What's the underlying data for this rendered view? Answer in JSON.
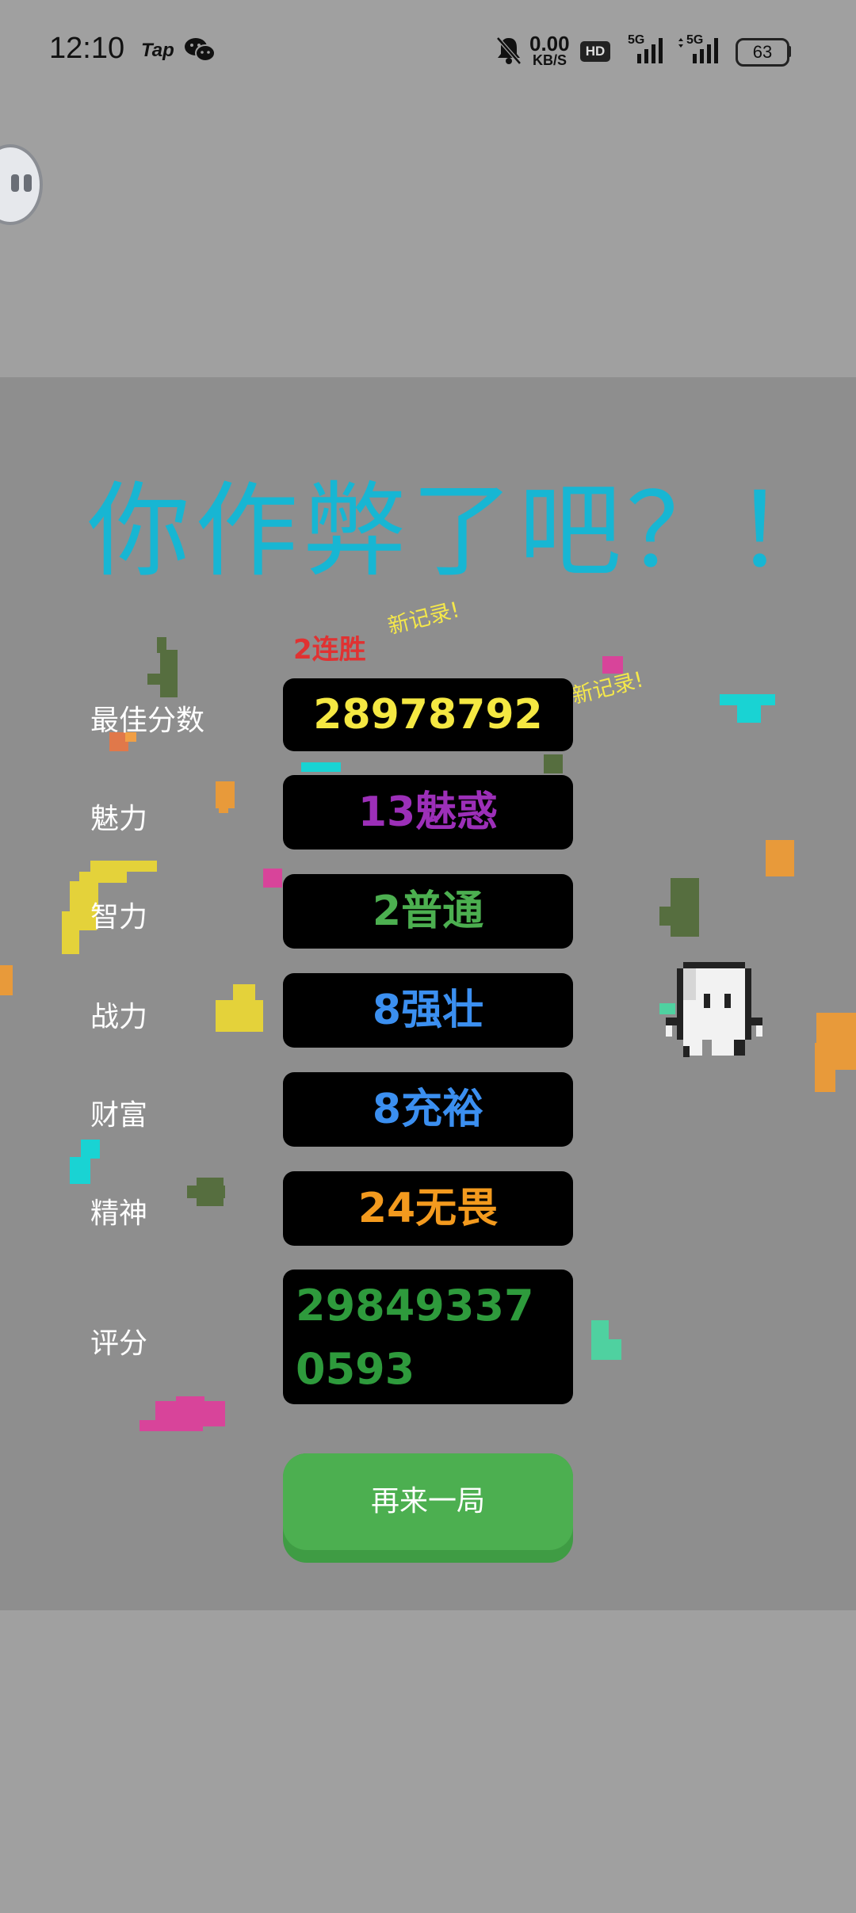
{
  "status_bar": {
    "time": "12:10",
    "app_tap": "Tap",
    "speed_value": "0.00",
    "speed_unit": "KB/S",
    "hd_badge": "HD",
    "network_1": "5G",
    "network_2": "5G",
    "battery": "63"
  },
  "game": {
    "headline": "你作弊了吧？！",
    "streak": "2连胜",
    "new_record_1": "新记录!",
    "new_record_2": "新记录!",
    "stats": [
      {
        "label": "最佳分数",
        "value": "28978792",
        "color": "#f5e842"
      },
      {
        "label": "魅力",
        "value": "13魅惑",
        "color": "#9c2fb8"
      },
      {
        "label": "智力",
        "value": "2普通",
        "color": "#4caf50"
      },
      {
        "label": "战力",
        "value": "8强壮",
        "color": "#3b8ff0"
      },
      {
        "label": "财富",
        "value": "8充裕",
        "color": "#3b8ff0"
      },
      {
        "label": "精神",
        "value": "24无畏",
        "color": "#f39a1e"
      }
    ],
    "score_label": "评分",
    "score_value": "298493370593",
    "play_again": "再来一局"
  }
}
